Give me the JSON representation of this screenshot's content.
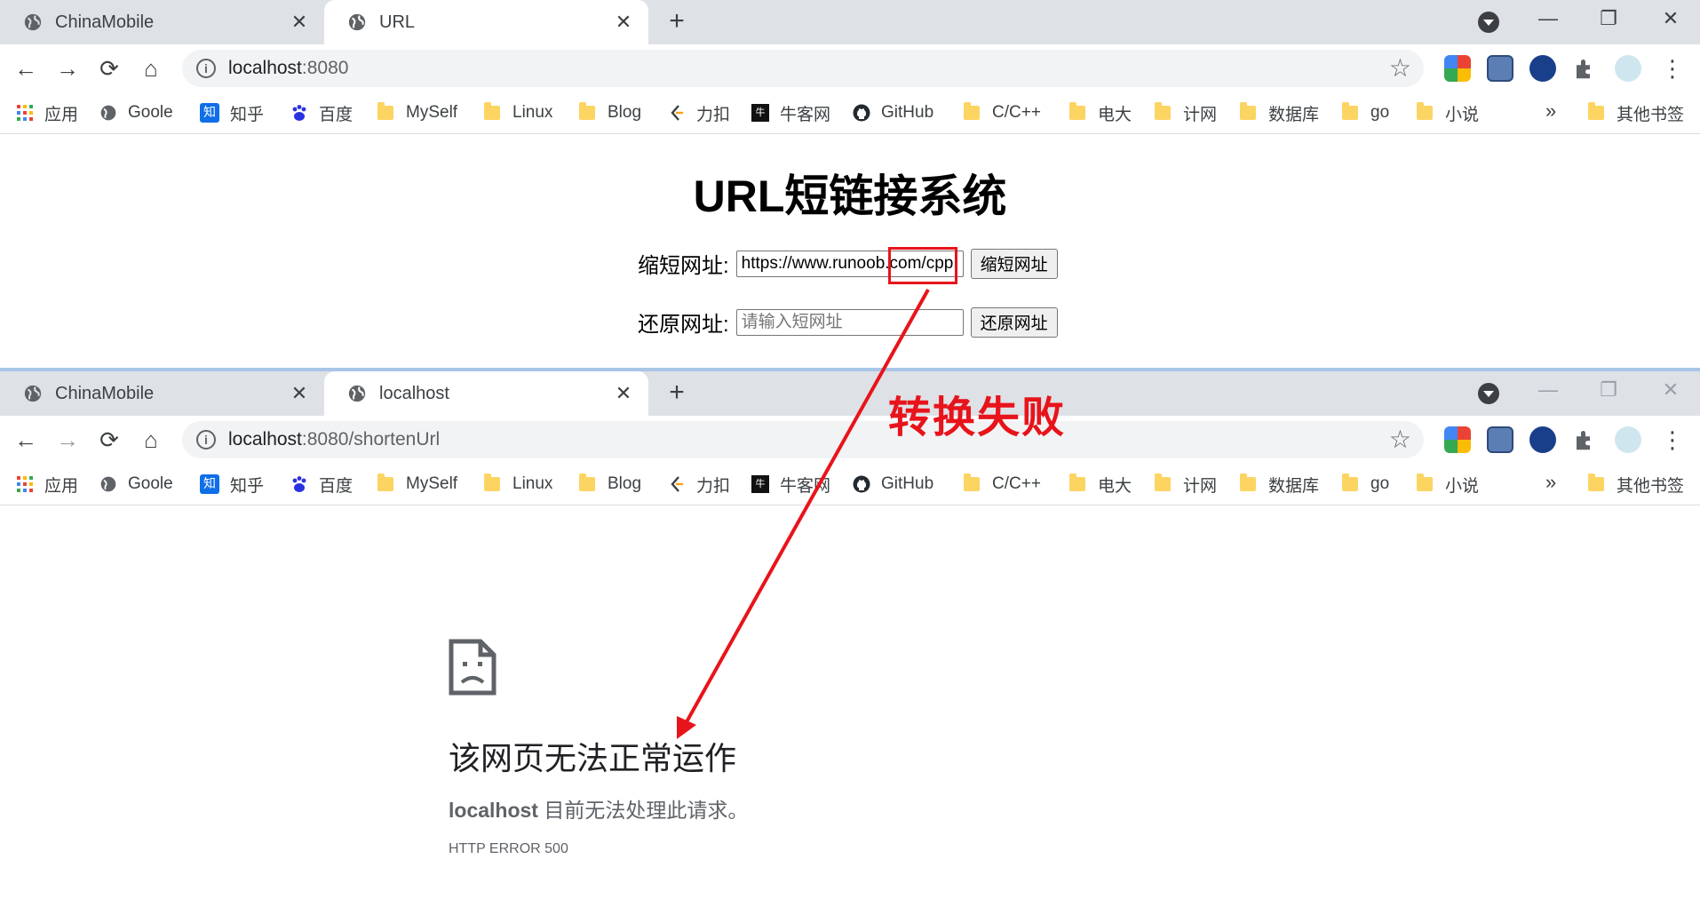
{
  "top_window": {
    "tabs": [
      {
        "title": "ChinaMobile",
        "active": false
      },
      {
        "title": "URL",
        "active": true
      }
    ],
    "address": {
      "host": "localhost",
      "path": ":8080"
    },
    "page": {
      "heading": "URL短链接系统",
      "shorten": {
        "label": "缩短网址:",
        "value": "https://www.runoob.com/cpp",
        "button": "缩短网址"
      },
      "restore": {
        "label": "还原网址:",
        "placeholder": "请输入短网址",
        "button": "还原网址"
      }
    }
  },
  "bottom_window": {
    "tabs": [
      {
        "title": "ChinaMobile",
        "active": false
      },
      {
        "title": "localhost",
        "active": true
      }
    ],
    "address": {
      "host": "localhost",
      "path": ":8080/shortenUrl"
    },
    "error": {
      "title": "该网页无法正常运作",
      "host": "localhost",
      "message": " 目前无法处理此请求。",
      "code": "HTTP ERROR 500"
    }
  },
  "bookmarks": {
    "items": [
      {
        "label": "应用",
        "icon": "apps-grid-icon"
      },
      {
        "label": "Goole",
        "icon": "globe-icon"
      },
      {
        "label": "知乎",
        "icon": "zhihu-icon"
      },
      {
        "label": "百度",
        "icon": "baidu-paw-icon"
      },
      {
        "label": "MySelf",
        "icon": "folder-icon"
      },
      {
        "label": "Linux",
        "icon": "folder-icon"
      },
      {
        "label": "Blog",
        "icon": "folder-icon"
      },
      {
        "label": "力扣",
        "icon": "leetcode-icon"
      },
      {
        "label": "牛客网",
        "icon": "nowcoder-icon"
      },
      {
        "label": "GitHub",
        "icon": "github-icon"
      },
      {
        "label": "C/C++",
        "icon": "folder-icon"
      },
      {
        "label": "电大",
        "icon": "folder-icon"
      },
      {
        "label": "计网",
        "icon": "folder-icon"
      },
      {
        "label": "数据库",
        "icon": "folder-icon"
      },
      {
        "label": "go",
        "icon": "folder-icon"
      },
      {
        "label": "小说",
        "icon": "folder-icon"
      }
    ],
    "more": "»",
    "other": "其他书签"
  },
  "glyphs": {
    "close": "✕",
    "new_tab": "+",
    "back": "←",
    "forward": "→",
    "reload": "⟳",
    "home": "⌂",
    "star": "☆",
    "menu": "⋮",
    "minimize": "—",
    "maximize": "❐",
    "window_close": "✕",
    "info": "i"
  },
  "annotation": {
    "text": "转换失败",
    "color": "#e8141b"
  }
}
